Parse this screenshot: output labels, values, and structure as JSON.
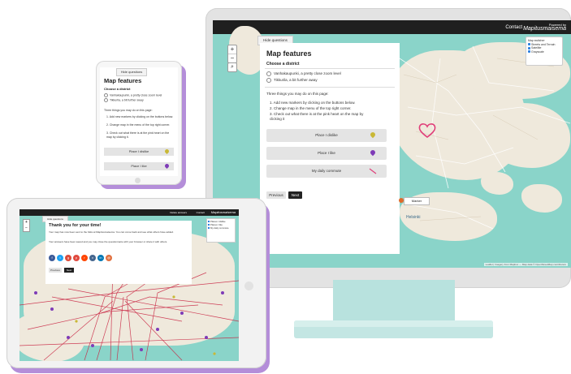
{
  "desktop": {
    "topbar": {
      "contact": "Contact",
      "brand_small": "Powered by",
      "brand_name": "Mapitusmaisema"
    },
    "hide_questions": "Hide questions",
    "panel": {
      "title": "Map features",
      "subtitle": "Choose a district",
      "options": [
        "Vanhakaupunki, a pretty close zoom level",
        "Tikkurila, a bit further away"
      ],
      "instructions_heading": "Three things you may do on this page:",
      "instructions": [
        "1. Add new markers by clicking on the buttons below.",
        "2. Change map in the menu of the top right corner.",
        "3. Check out what there is at the pink heart on the map by clicking it"
      ],
      "buttons": [
        "Place I dislike",
        "Place I like",
        "My daily commute"
      ],
      "previous": "Previous",
      "next": "Next"
    },
    "legend": {
      "title": "Map switcher",
      "items": [
        "Streets and Terrain",
        "Satellite",
        "Grayscale"
      ]
    },
    "marker_label": "Marker",
    "city_label": "Helsinki",
    "attribution": "Leaflet | Imagery from Mapbox — Map data © OpenStreetMap contributors",
    "colors": {
      "heart": "#e0407a",
      "pin_yellow": "#c9b836",
      "pin_purple": "#7e3bb7",
      "commute": "#e0407a",
      "next_button": "#222222"
    }
  },
  "phone": {
    "hide_questions": "Hide questions",
    "title": "Map features",
    "subtitle": "Choose a district",
    "options": [
      "Vanhakaupunki, a pretty close zoom level",
      "Tikkurila, a bit further away"
    ],
    "instructions_heading": "Three things you may do on this page:",
    "instructions": [
      "1. Add new markers by clicking on the buttons below.",
      "2. Change map in the menu of the top right corner.",
      "3. Check out what there is at the pink heart on the map by clicking it."
    ],
    "buttons": [
      "Place I dislike",
      "Place I like"
    ]
  },
  "tablet": {
    "topbar": {
      "left": "Delete answers",
      "contact": "Contact",
      "brand_name": "Mapitusmaisema"
    },
    "hide_questions": "Hide questions",
    "title": "Thank you for your time!",
    "text1": "Your map has now been sent to the folks at Mapitusmaisema. You can come back and see what others have added.",
    "text2": "Your answers have been saved and you may close the questionnaire with your browser or share it with others.",
    "previous": "Previous",
    "next": "Next",
    "legend_items": [
      "Places I dislike",
      "Places I like",
      "My daily commute"
    ]
  }
}
